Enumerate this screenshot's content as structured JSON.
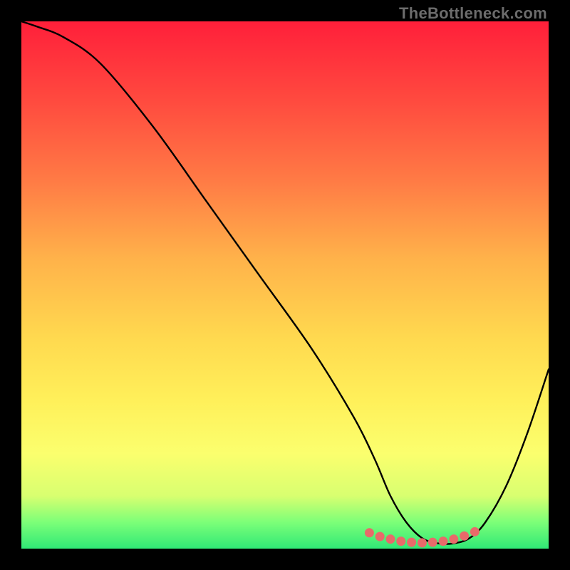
{
  "watermark": "TheBottleneck.com",
  "chart_data": {
    "type": "line",
    "title": "",
    "xlabel": "",
    "ylabel": "",
    "xlim": [
      0,
      100
    ],
    "ylim": [
      0,
      100
    ],
    "series": [
      {
        "name": "bottleneck-curve",
        "x": [
          0,
          3,
          8,
          15,
          25,
          35,
          45,
          55,
          63,
          67,
          70,
          73,
          76,
          79,
          82,
          85,
          88,
          92,
          96,
          100
        ],
        "y": [
          100,
          99,
          97,
          92,
          80,
          66,
          52,
          38,
          25,
          17,
          10,
          5,
          2,
          1,
          1,
          2,
          5,
          12,
          22,
          34
        ]
      }
    ],
    "marked_points": {
      "name": "bottom-dots",
      "x": [
        66,
        68,
        70,
        72,
        74,
        76,
        78,
        80,
        82,
        84,
        86
      ],
      "y": [
        3,
        2.3,
        1.8,
        1.4,
        1.2,
        1.1,
        1.2,
        1.4,
        1.8,
        2.4,
        3.2
      ]
    },
    "gradient_colors": {
      "top": "#ff1f3a",
      "mid_upper": "#ffb24a",
      "mid": "#ffd94f",
      "mid_lower": "#fbff6e",
      "bottom": "#30e876"
    }
  }
}
